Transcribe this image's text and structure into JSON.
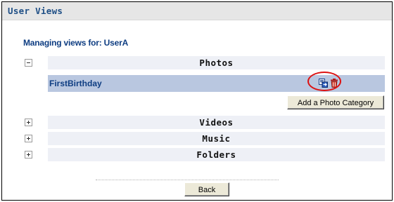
{
  "panel": {
    "title": "User Views"
  },
  "managing_label": "Managing views for: UserA",
  "categories": [
    {
      "label": "Photos",
      "expanded": true
    },
    {
      "label": "Videos",
      "expanded": false
    },
    {
      "label": "Music",
      "expanded": false
    },
    {
      "label": "Folders",
      "expanded": false
    }
  ],
  "photo_items": [
    {
      "label": "FirstBirthday",
      "icons": [
        "edit-view-icon",
        "delete-icon"
      ]
    }
  ],
  "buttons": {
    "add_category": "Add a Photo Category",
    "back": "Back"
  },
  "colors": {
    "title_text": "#1f4f86",
    "link_text": "#0e3d82",
    "item_bar": "#b9c7e0",
    "category_bar": "#eef0f6",
    "highlight": "#dd1111"
  }
}
